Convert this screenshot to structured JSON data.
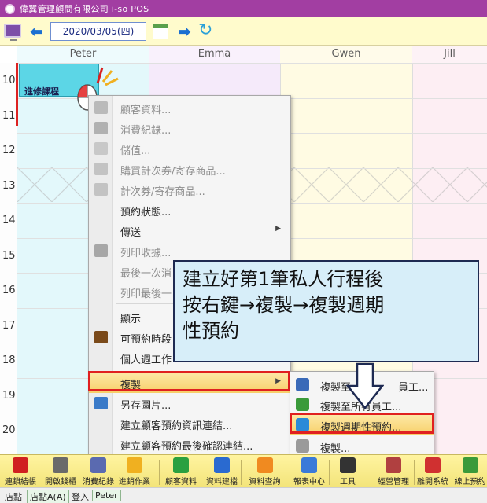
{
  "window": {
    "title": "偉翼管理顧問有限公司 i-so POS"
  },
  "toolbar": {
    "date": "2020/03/05(四)"
  },
  "staff_columns": [
    {
      "name": "Peter",
      "bg": "#e3f8fb"
    },
    {
      "name": "Emma",
      "bg": "#f5eafa"
    },
    {
      "name": "Gwen",
      "bg": "#fffbe3"
    },
    {
      "name": "Jill",
      "bg": "#fdeef3"
    }
  ],
  "hours": [
    "10",
    "11",
    "12",
    "13",
    "14",
    "15",
    "16",
    "17",
    "18",
    "19",
    "20"
  ],
  "appointment": {
    "label": "進修課程",
    "color": "#5cd6e6"
  },
  "context_menu": {
    "items": [
      {
        "label": "顧客資料...",
        "disabled": true,
        "icon": "file-icon"
      },
      {
        "label": "消費紀錄...",
        "disabled": true,
        "icon": "list-icon"
      },
      {
        "label": "儲值...",
        "disabled": true,
        "icon": "money-icon"
      },
      {
        "label": "購買計次券/寄存商品...",
        "disabled": true,
        "icon": "ticket-icon"
      },
      {
        "label": "計次券/寄存商品...",
        "disabled": true,
        "icon": "ticket-icon"
      },
      {
        "label": "預約狀態...",
        "disabled": false,
        "icon": ""
      },
      {
        "label": "傳送",
        "disabled": false,
        "icon": "",
        "submenu": true
      },
      {
        "label": "列印收據...",
        "disabled": true,
        "icon": "printer-icon"
      },
      {
        "label": "最後一次消",
        "disabled": true,
        "icon": ""
      },
      {
        "label": "列印最後一",
        "disabled": true,
        "icon": ""
      },
      {
        "label": "顯示",
        "disabled": false,
        "icon": ""
      },
      {
        "label": "可預約時段",
        "disabled": false,
        "icon": "book-icon"
      },
      {
        "label": "個人週工作",
        "disabled": false,
        "icon": ""
      },
      {
        "label": "複製",
        "disabled": false,
        "icon": "",
        "submenu": true,
        "highlighted": true
      },
      {
        "label": "另存圖片...",
        "disabled": false,
        "icon": "save-image-icon"
      },
      {
        "label": "建立顧客預約資訊連結...",
        "disabled": false,
        "icon": ""
      },
      {
        "label": "建立顧客預約最後確認連結...",
        "disabled": false,
        "icon": ""
      }
    ]
  },
  "copy_submenu": {
    "items": [
      {
        "label": "複製至",
        "suffix": "員工...",
        "icon": "person-icon"
      },
      {
        "label": "複製至所有員工...",
        "icon": "people-icon"
      },
      {
        "label": "複製週期性預約...",
        "icon": "recurring-icon",
        "highlighted": true
      },
      {
        "label": "複製...",
        "icon": "document-icon"
      }
    ]
  },
  "callout": {
    "lines": [
      "建立好第1筆私人行程後",
      "按右鍵→複製→複製週期",
      "性預約"
    ]
  },
  "bottom_nav": [
    {
      "label": "連鎖結帳",
      "icon_color": "#d02020"
    },
    {
      "label": "開啟錢櫃",
      "icon_color": "#6a6a6a"
    },
    {
      "label": "消費紀錄",
      "icon_color": "#5a6ab0"
    },
    {
      "label": "進銷作業",
      "icon_color": "#f0b020"
    },
    {
      "label": "顧客資料",
      "icon_color": "#2aa040"
    },
    {
      "label": "資料建檔",
      "icon_color": "#2a6ad0"
    },
    {
      "label": "資料查詢",
      "icon_color": "#f08a20"
    },
    {
      "label": "報表中心",
      "icon_color": "#3a7ad8"
    },
    {
      "label": "工具",
      "icon_color": "#333333"
    },
    {
      "label": "經營管理",
      "icon_color": "#b04040"
    },
    {
      "label": "離開系統",
      "icon_color": "#d03030"
    },
    {
      "label": "線上預約",
      "icon_color": "#3a9a3a"
    }
  ],
  "status_bar": {
    "store_label": "店點",
    "store_value": "店點A(A)",
    "login_label": "登入",
    "login_value": "Peter"
  }
}
